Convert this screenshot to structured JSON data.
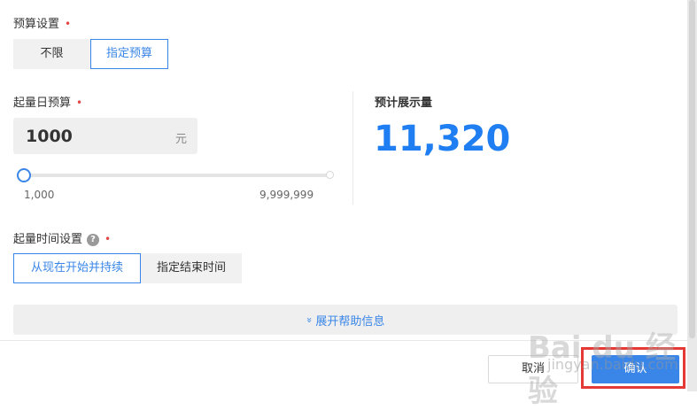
{
  "budget_settings": {
    "label": "预算设置",
    "required_mark": "•",
    "options": [
      "不限",
      "指定预算"
    ],
    "selected": "指定预算"
  },
  "daily_budget": {
    "label": "起量日预算",
    "required_mark": "•",
    "value": "1000",
    "unit": "元",
    "slider_min": "1,000",
    "slider_max": "9,999,999",
    "slider_level": 0.0
  },
  "estimate": {
    "label": "预计展示量",
    "value": "11,320"
  },
  "time_settings": {
    "label": "起量时间设置",
    "help_glyph": "?",
    "required_mark": "•",
    "options": [
      "从现在开始并持续",
      "指定结束时间"
    ],
    "selected": "从现在开始并持续"
  },
  "expand": {
    "chevron": "»",
    "label": "展开帮助信息"
  },
  "footer": {
    "cancel_label": "取消",
    "confirm_label": "确认"
  },
  "watermark": {
    "brand": "Bai du 经验",
    "url": "jingyan.baidu.com"
  },
  "colors": {
    "accent": "#3a86e8",
    "estimate": "#1f7ef2",
    "required": "#e64545",
    "highlight": "#e53935"
  }
}
